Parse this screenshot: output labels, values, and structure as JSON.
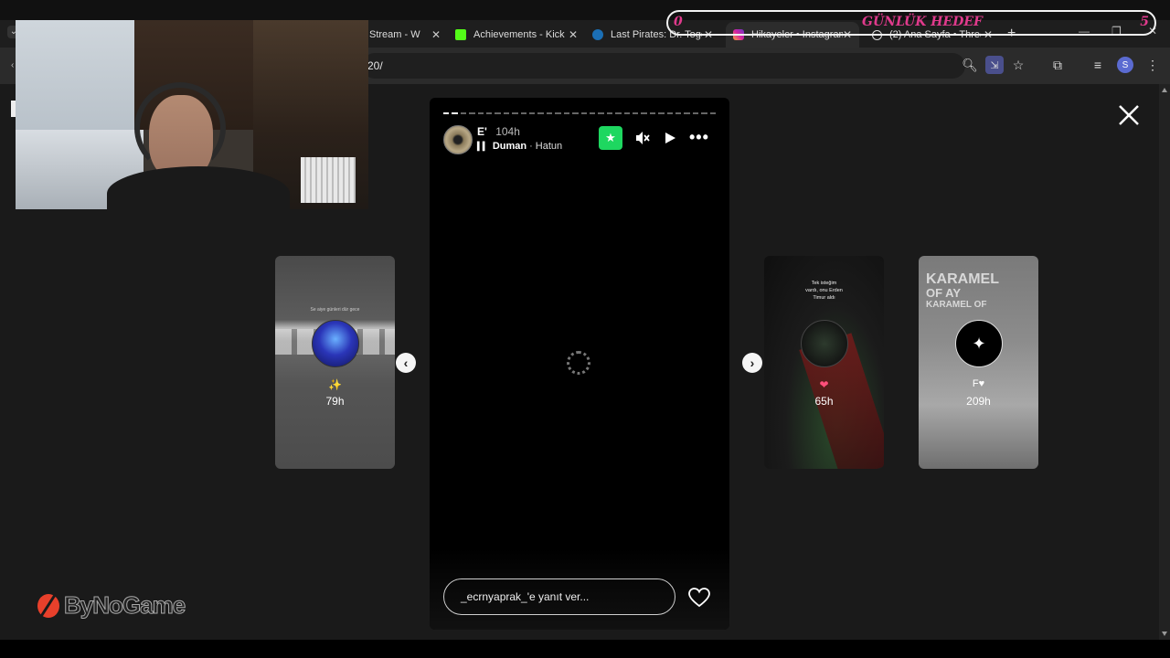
{
  "tabs": [
    {
      "title": "Stream - W",
      "icon": "window-icon"
    },
    {
      "title": "Achievements - Kick",
      "icon": "kick-icon"
    },
    {
      "title": "Last Pirates: Dr. Toge",
      "icon": "steam-icon"
    },
    {
      "title": "Hikayeler • Instagram",
      "icon": "instagram-icon"
    },
    {
      "title": "(2) Ana Sayfa • Threa",
      "icon": "threads-icon"
    }
  ],
  "url_fragment": "20/",
  "goal": {
    "title": "GÜNLÜK HEDEF",
    "current": "0",
    "target": "5"
  },
  "story": {
    "username": "E'",
    "time": "104h",
    "music_artist": "Duman",
    "music_song": "Hatun",
    "reply_placeholder": "_ecrnyaprak_'e yanıt ver..."
  },
  "left_card": {
    "caption": "Se aiye günleri dür gece",
    "emoji": "✨",
    "time": "79h"
  },
  "right_cards": [
    {
      "caption_lines": [
        "Tek isteğim",
        "vardı, onu Erden",
        "Timur aldı"
      ],
      "emoji": "❤",
      "time": "65h"
    },
    {
      "overlay_lines": [
        "KARAMEL",
        "OF AY",
        "KARAMEL OF"
      ],
      "emoji": "F♥",
      "time": "209h"
    }
  ],
  "watermark": "ByNoGame",
  "avatar_letter": "S"
}
